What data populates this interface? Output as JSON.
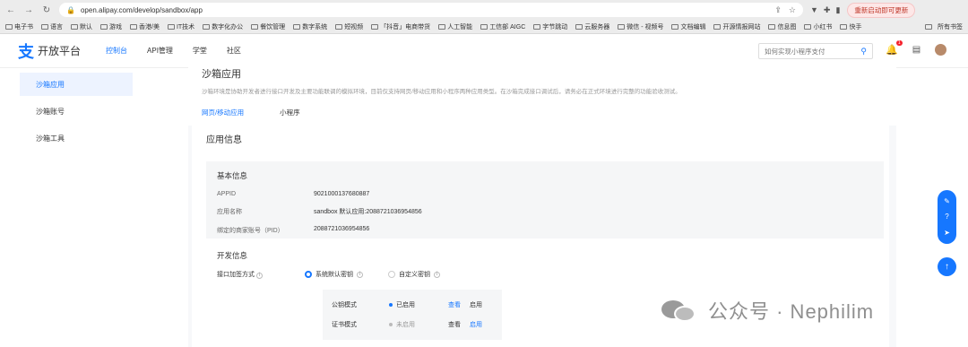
{
  "browser": {
    "url": "open.alipay.com/develop/sandbox/app",
    "restart_label": "重新启动即可更新",
    "bookmarks": [
      "电子书",
      "语言",
      "默认",
      "游戏",
      "香港/美",
      "IT技术",
      "数字化办公",
      "餐饮管理",
      "数字系统",
      "短视频",
      "「抖音」电商带货",
      "人工智能",
      "工信部 AIGC",
      "字节跳动",
      "云服务器",
      "微信 - 视频号",
      "文档编辑",
      "开源情报网站",
      "信息图",
      "小红书",
      "快手"
    ],
    "all_bookmarks": "所有书签"
  },
  "topnav": {
    "logo_text": "开放平台",
    "items": [
      "控制台",
      "API管理",
      "学堂",
      "社区"
    ],
    "search_placeholder": "如何实现小程序支付",
    "bell_badge": "1"
  },
  "sidebar": {
    "items": [
      "沙箱应用",
      "沙箱账号",
      "沙箱工具"
    ]
  },
  "main": {
    "title": "沙箱应用",
    "description": "沙箱环境是协助开发者进行接口开发及主要功能联调的模拟环境，目前仅支持网页/移动应用和小程序两种应用类型。在沙箱完成接口调试后，请务必在正式环境进行完整的功能验收测试。",
    "tabs": [
      "网页/移动应用",
      "小程序"
    ],
    "section_title": "应用信息",
    "basic_info": {
      "title": "基本信息",
      "rows": [
        {
          "label": "APPID",
          "value": "9021000137680887"
        },
        {
          "label": "应用名称",
          "value": "sandbox 默认应用:2088721036954856"
        },
        {
          "label": "绑定的商家账号（PID）",
          "value": "2088721036954856"
        }
      ]
    },
    "dev_info": {
      "title": "开发信息",
      "sign_label": "接口加签方式",
      "options": [
        "系统默认密钥",
        "自定义密钥"
      ],
      "modes": [
        {
          "name": "公钥模式",
          "status": "已启用",
          "status_color": "#1677ff",
          "actions": [
            "查看",
            "启用"
          ]
        },
        {
          "name": "证书模式",
          "status": "未启用",
          "status_color": "#bbbbbb",
          "actions": [
            "查看",
            "启用"
          ]
        }
      ]
    }
  },
  "watermark": "公众号 · Nephilim"
}
